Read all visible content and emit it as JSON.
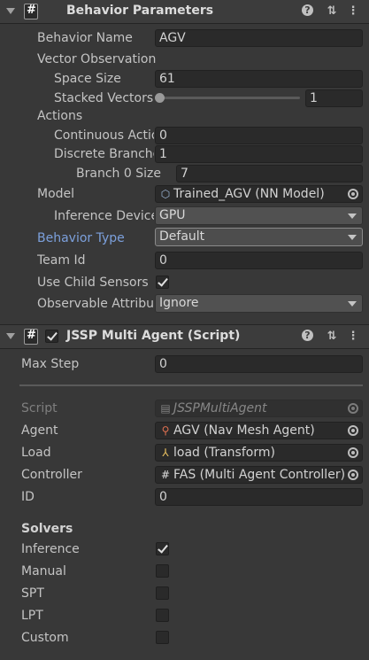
{
  "behavior_params": {
    "title": "Behavior Parameters",
    "behavior_name_label": "Behavior Name",
    "behavior_name_value": "AGV",
    "vector_observation_label": "Vector Observation",
    "space_size_label": "Space Size",
    "space_size_value": "61",
    "stacked_vectors_label": "Stacked Vectors",
    "stacked_vectors_value": "1",
    "actions_label": "Actions",
    "continuous_actions_label": "Continuous Actions",
    "continuous_actions_value": "0",
    "discrete_branches_label": "Discrete Branches",
    "discrete_branches_value": "1",
    "branch0_label": "Branch 0 Size",
    "branch0_value": "7",
    "model_label": "Model",
    "model_value": "Trained_AGV (NN Model)",
    "inference_device_label": "Inference Device",
    "inference_device_value": "GPU",
    "behavior_type_label": "Behavior Type",
    "behavior_type_value": "Default",
    "team_id_label": "Team Id",
    "team_id_value": "0",
    "use_child_sensors_label": "Use Child Sensors",
    "use_child_sensors_checked": true,
    "observable_attr_label": "Observable Attribute Handling",
    "observable_attr_value": "Ignore"
  },
  "jssp": {
    "title": "JSSP Multi Agent (Script)",
    "enabled": true,
    "max_step_label": "Max Step",
    "max_step_value": "0",
    "script_label": "Script",
    "script_value": "JSSPMultiAgent",
    "agent_label": "Agent",
    "agent_value": "AGV (Nav Mesh Agent)",
    "load_label": "Load",
    "load_value": "load (Transform)",
    "controller_label": "Controller",
    "controller_value": "FAS (Multi Agent Controller)",
    "id_label": "ID",
    "id_value": "0",
    "solvers_label": "Solvers",
    "solvers": [
      {
        "label": "Inference",
        "checked": true
      },
      {
        "label": "Manual",
        "checked": false
      },
      {
        "label": "SPT",
        "checked": false
      },
      {
        "label": "LPT",
        "checked": false
      },
      {
        "label": "Custom",
        "checked": false
      }
    ]
  },
  "colors": {
    "background": "#383838",
    "header": "#3c3c3c",
    "field": "#2a2a2a",
    "highlight_label": "#7ca0dc",
    "dropdown_border_focus": "#a0a0a0"
  }
}
